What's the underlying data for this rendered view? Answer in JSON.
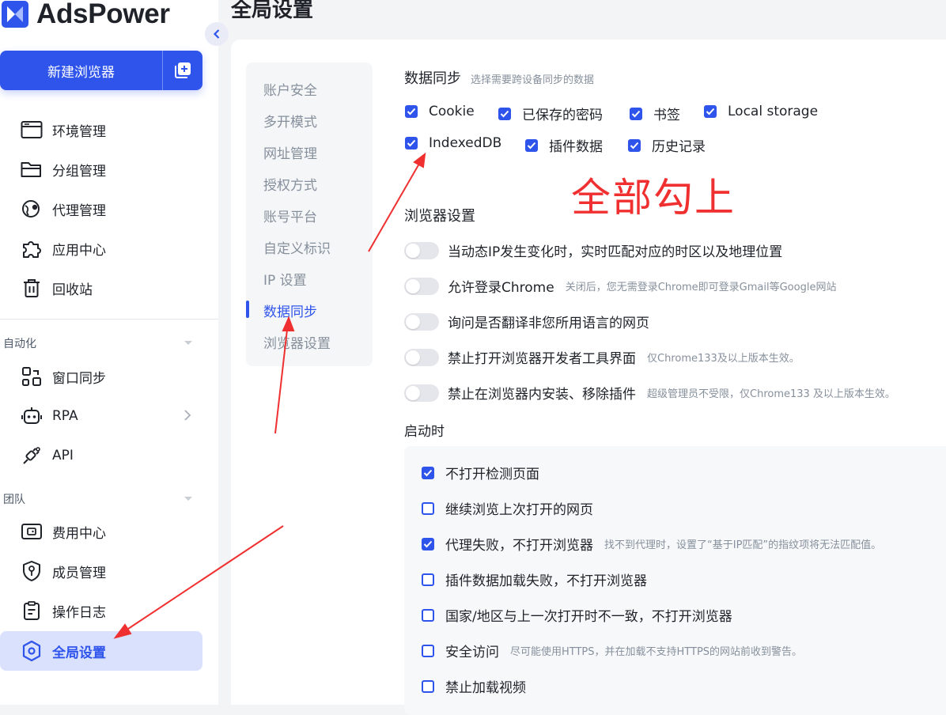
{
  "app": {
    "name": "AdsPower",
    "page_title": "全局设置"
  },
  "sidebar": {
    "new_browser_label": "新建浏览器",
    "items_main": [
      {
        "label": "环境管理",
        "icon": "browser-window-icon"
      },
      {
        "label": "分组管理",
        "icon": "folder-icon"
      },
      {
        "label": "代理管理",
        "icon": "globe-pin-icon"
      },
      {
        "label": "应用中心",
        "icon": "puzzle-icon"
      },
      {
        "label": "回收站",
        "icon": "trash-icon"
      }
    ],
    "section_automation": "自动化",
    "items_automation": [
      {
        "label": "窗口同步",
        "icon": "window-sync-icon"
      },
      {
        "label": "RPA",
        "icon": "robot-icon"
      },
      {
        "label": "API",
        "icon": "plug-icon"
      }
    ],
    "section_team": "团队",
    "items_team": [
      {
        "label": "费用中心",
        "icon": "wallet-icon"
      },
      {
        "label": "成员管理",
        "icon": "shield-user-icon"
      },
      {
        "label": "操作日志",
        "icon": "clipboard-icon"
      },
      {
        "label": "全局设置",
        "icon": "hexagon-settings-icon"
      }
    ]
  },
  "subnav": {
    "items": [
      "账户安全",
      "多开模式",
      "网址管理",
      "授权方式",
      "账号平台",
      "自定义标识",
      "IP 设置",
      "数据同步",
      "浏览器设置"
    ],
    "active_index": 7
  },
  "data_sync": {
    "title": "数据同步",
    "hint": "选择需要跨设备同步的数据",
    "options": [
      {
        "label": "Cookie",
        "checked": true
      },
      {
        "label": "已保存的密码",
        "checked": true
      },
      {
        "label": "书签",
        "checked": true
      },
      {
        "label": "Local storage",
        "checked": true
      },
      {
        "label": "IndexedDB",
        "checked": true
      },
      {
        "label": "插件数据",
        "checked": true
      },
      {
        "label": "历史记录",
        "checked": true
      }
    ]
  },
  "browser_settings": {
    "title": "浏览器设置",
    "toggles": [
      {
        "label": "当动态IP发生变化时，实时匹配对应的时区以及地理位置",
        "note": "",
        "on": false
      },
      {
        "label": "允许登录Chrome",
        "note": "关闭后，您无需登录Chrome即可登录Gmail等Google网站",
        "on": false
      },
      {
        "label": "询问是否翻译非您所用语言的网页",
        "note": "",
        "on": false
      },
      {
        "label": "禁止打开浏览器开发者工具界面",
        "note": "仅Chrome133及以上版本生效。",
        "on": false
      },
      {
        "label": "禁止在浏览器内安装、移除插件",
        "note": "超级管理员不受限，仅Chrome133 及以上版本生效。",
        "on": false
      }
    ]
  },
  "startup": {
    "title": "启动时",
    "options": [
      {
        "label": "不打开检测页面",
        "note": "",
        "checked": true
      },
      {
        "label": "继续浏览上次打开的网页",
        "note": "",
        "checked": false
      },
      {
        "label": "代理失败，不打开浏览器",
        "note": "找不到代理时，设置了“基于IP匹配”的指纹项将无法匹配值。",
        "checked": true
      },
      {
        "label": "插件数据加载失败，不打开浏览器",
        "note": "",
        "checked": false
      },
      {
        "label": "国家/地区与上一次打开时不一致，不打开浏览器",
        "note": "",
        "checked": false
      },
      {
        "label": "安全访问",
        "note": "尽可能使用HTTPS，并在加载不支持HTTPS的网站前收到警告。",
        "checked": false
      },
      {
        "label": "禁止加载视频",
        "note": "",
        "checked": false
      }
    ]
  },
  "annotation": {
    "text": "全部勾上",
    "color": "#f03030"
  },
  "colors": {
    "accent": "#2f54eb",
    "active_bg": "#d9e1fd",
    "annotation_red": "#f03030"
  }
}
